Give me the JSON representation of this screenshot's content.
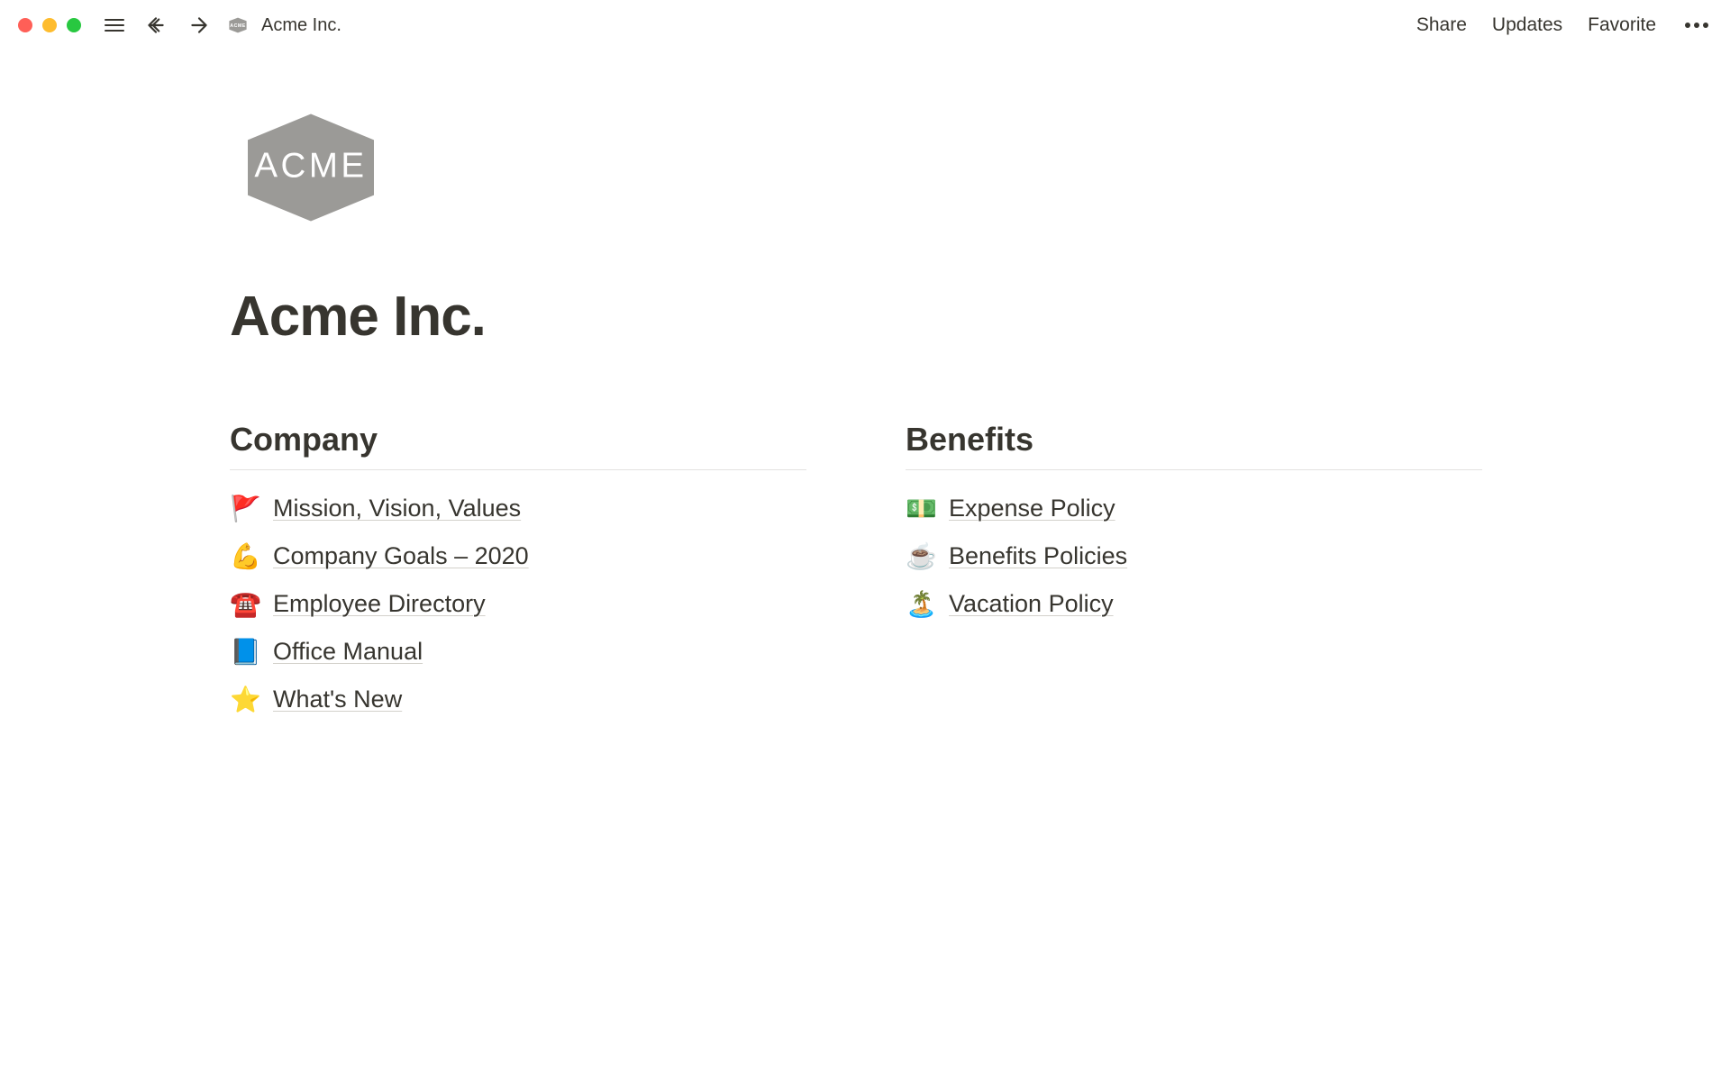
{
  "breadcrumb": {
    "title": "Acme Inc.",
    "icon_label": "ACME"
  },
  "topbar": {
    "share": "Share",
    "updates": "Updates",
    "favorite": "Favorite"
  },
  "page": {
    "icon_label": "ACME",
    "title": "Acme Inc."
  },
  "sections": {
    "company": {
      "heading": "Company",
      "links": [
        {
          "emoji": "🚩",
          "text": "Mission, Vision, Values"
        },
        {
          "emoji": "💪",
          "text": "Company Goals – 2020"
        },
        {
          "emoji": "☎️",
          "text": "Employee Directory"
        },
        {
          "emoji": "📘",
          "text": "Office Manual"
        },
        {
          "emoji": "⭐",
          "text": "What's New"
        }
      ]
    },
    "benefits": {
      "heading": "Benefits",
      "links": [
        {
          "emoji": "💵",
          "text": "Expense Policy"
        },
        {
          "emoji": "☕",
          "text": "Benefits Policies"
        },
        {
          "emoji": "🏝️",
          "text": "Vacation Policy"
        }
      ]
    }
  }
}
